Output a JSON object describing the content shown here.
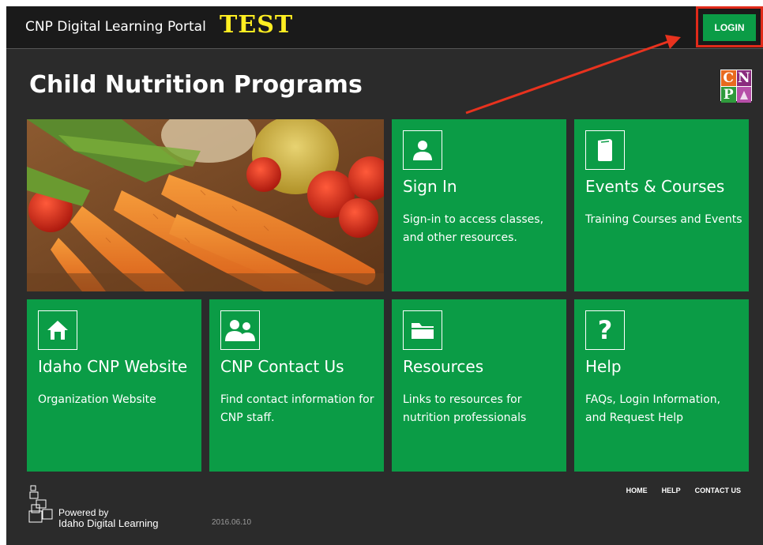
{
  "header": {
    "portal_title": "CNP Digital Learning Portal",
    "test_label": "TEST",
    "login_label": "LOGIN"
  },
  "page": {
    "title": "Child Nutrition Programs"
  },
  "logo": {
    "letters": [
      "C",
      "N",
      "P",
      ""
    ],
    "colors": [
      "#e86a1e",
      "#8a2b7e",
      "#2f9a3c",
      "#b64fa8"
    ]
  },
  "tiles": [
    {
      "title": "Sign In",
      "desc": "Sign-in to access classes, and other resources.",
      "icon": "person-icon"
    },
    {
      "title": "Events & Courses",
      "desc": "Training Courses and Events",
      "icon": "book-icon"
    },
    {
      "title": "Idaho CNP Website",
      "desc": "Organization Website",
      "icon": "home-icon"
    },
    {
      "title": "CNP Contact Us",
      "desc": "Find contact information for CNP staff.",
      "icon": "people-icon"
    },
    {
      "title": "Resources",
      "desc": "Links to resources for nutrition professionals",
      "icon": "folder-icon"
    },
    {
      "title": "Help",
      "desc": "FAQs, Login Information, and Request Help",
      "icon": "question-icon"
    }
  ],
  "footer": {
    "powered_line1": "Powered by",
    "powered_line2": "Idaho Digital Learning",
    "version": "2016.06.10",
    "links": [
      "HOME",
      "HELP",
      "CONTACT US"
    ]
  },
  "colors": {
    "tile_green": "#0b9c46",
    "background": "#2b2b2b",
    "header": "#1a1a1a",
    "highlight": "#e02a1a",
    "test_yellow": "#ffee22"
  }
}
